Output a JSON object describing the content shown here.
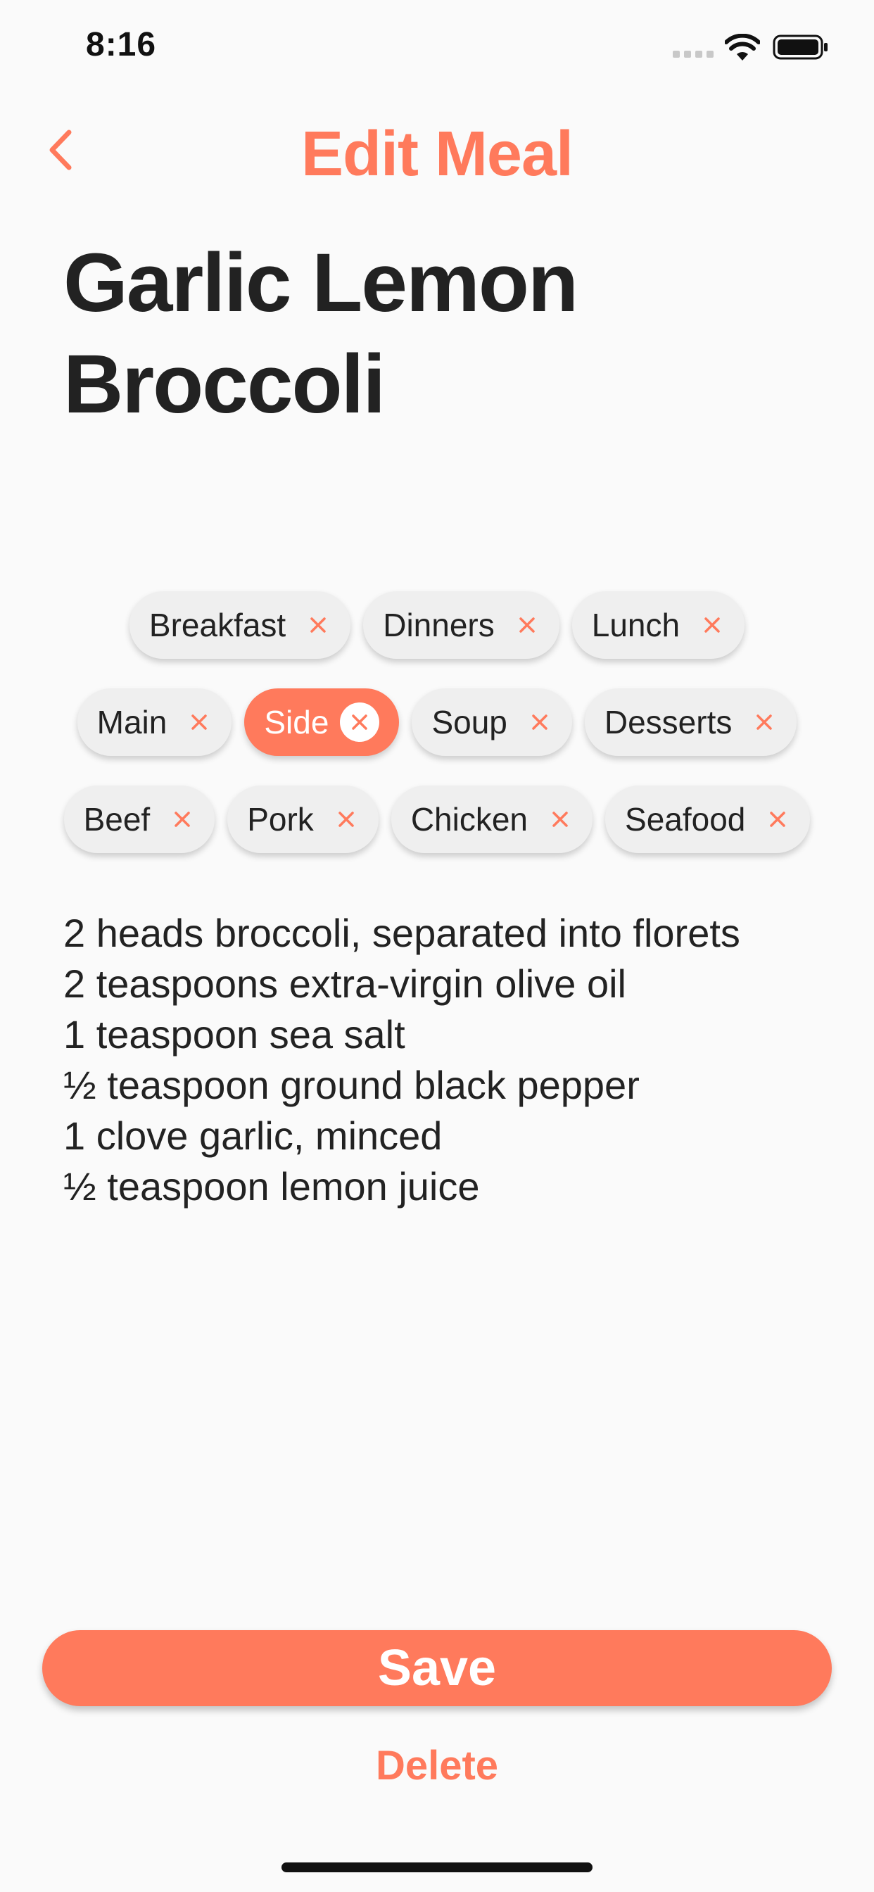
{
  "status_bar": {
    "time": "8:16",
    "icons": [
      "cellular-signal-icon",
      "wifi-icon",
      "battery-icon"
    ]
  },
  "nav": {
    "back_icon": "chevron-left-icon",
    "title": "Edit Meal"
  },
  "meal": {
    "title_line1": "Garlic Lemon",
    "title_line2": "Broccoli"
  },
  "tags": {
    "rows": [
      [
        {
          "label": "Breakfast",
          "selected": false
        },
        {
          "label": "Dinners",
          "selected": false
        },
        {
          "label": "Lunch",
          "selected": false
        }
      ],
      [
        {
          "label": "Main",
          "selected": false
        },
        {
          "label": "Side",
          "selected": true
        },
        {
          "label": "Soup",
          "selected": false
        },
        {
          "label": "Desserts",
          "selected": false
        }
      ],
      [
        {
          "label": "Beef",
          "selected": false
        },
        {
          "label": "Pork",
          "selected": false
        },
        {
          "label": "Chicken",
          "selected": false
        },
        {
          "label": "Seafood",
          "selected": false
        }
      ]
    ]
  },
  "ingredients": [
    "2 heads broccoli, separated into florets",
    "2 teaspoons extra-virgin olive oil",
    "1 teaspoon sea salt",
    "½ teaspoon ground black pepper",
    "1 clove garlic, minced",
    "½ teaspoon lemon juice"
  ],
  "actions": {
    "save_label": "Save",
    "delete_label": "Delete"
  },
  "colors": {
    "accent": "#FF7A5C",
    "tag_background": "#EFEFEF",
    "text": "#222222",
    "background": "#FAFAFA"
  }
}
